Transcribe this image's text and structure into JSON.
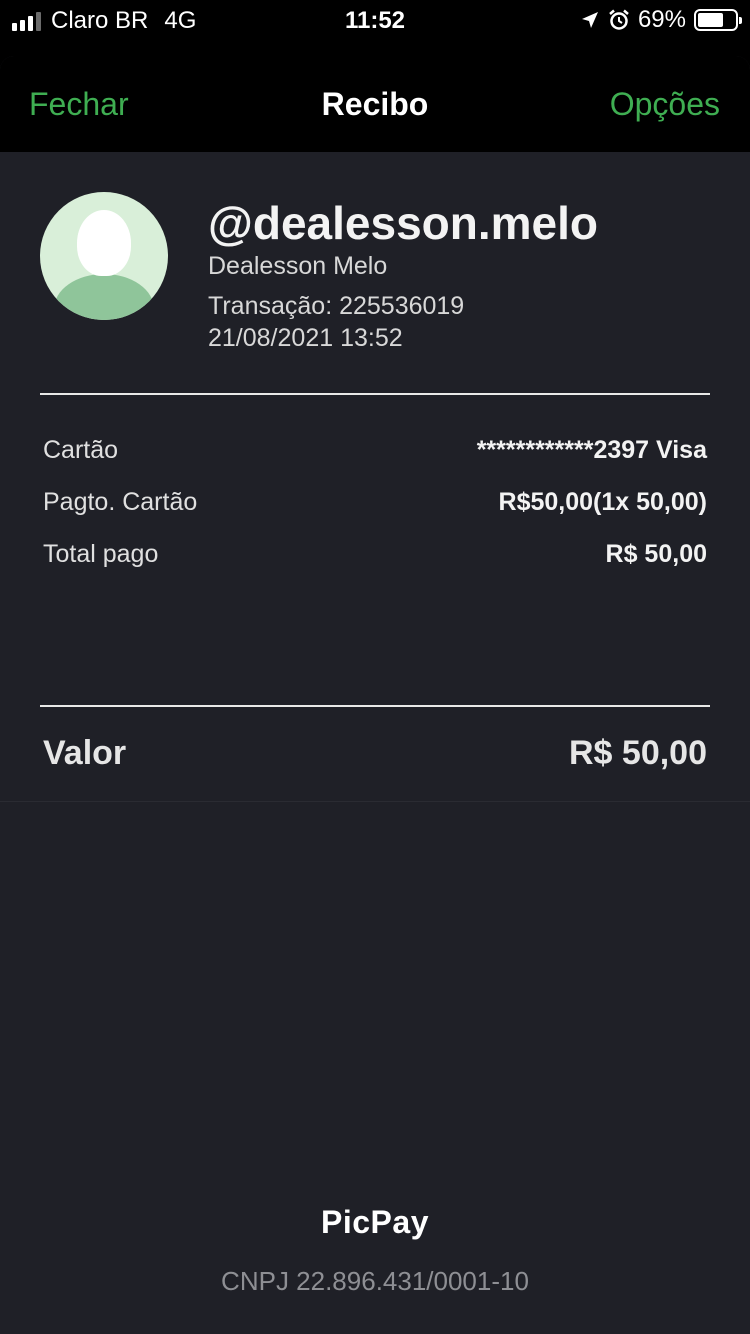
{
  "status_bar": {
    "carrier": "Claro BR",
    "network": "4G",
    "time": "11:52",
    "battery_percent": "69%",
    "battery_level": 0.69
  },
  "nav": {
    "close_label": "Fechar",
    "title": "Recibo",
    "options_label": "Opções"
  },
  "profile": {
    "username": "@dealesson.melo",
    "full_name": "Dealesson Melo",
    "transaction": "Transação: 225536019",
    "datetime": "21/08/2021 13:52"
  },
  "details": [
    {
      "label": "Cartão",
      "value": "************2397 Visa"
    },
    {
      "label": "Pagto. Cartão",
      "value": "R$50,00(1x 50,00)"
    },
    {
      "label": "Total pago",
      "value": "R$ 50,00"
    }
  ],
  "valor": {
    "label": "Valor",
    "amount": "R$ 50,00"
  },
  "footer": {
    "logo": "PicPay",
    "cnpj": "CNPJ 22.896.431/0001-10"
  },
  "colors": {
    "accent": "#3fae52",
    "background": "#1f2027",
    "nav_background": "#000000"
  }
}
